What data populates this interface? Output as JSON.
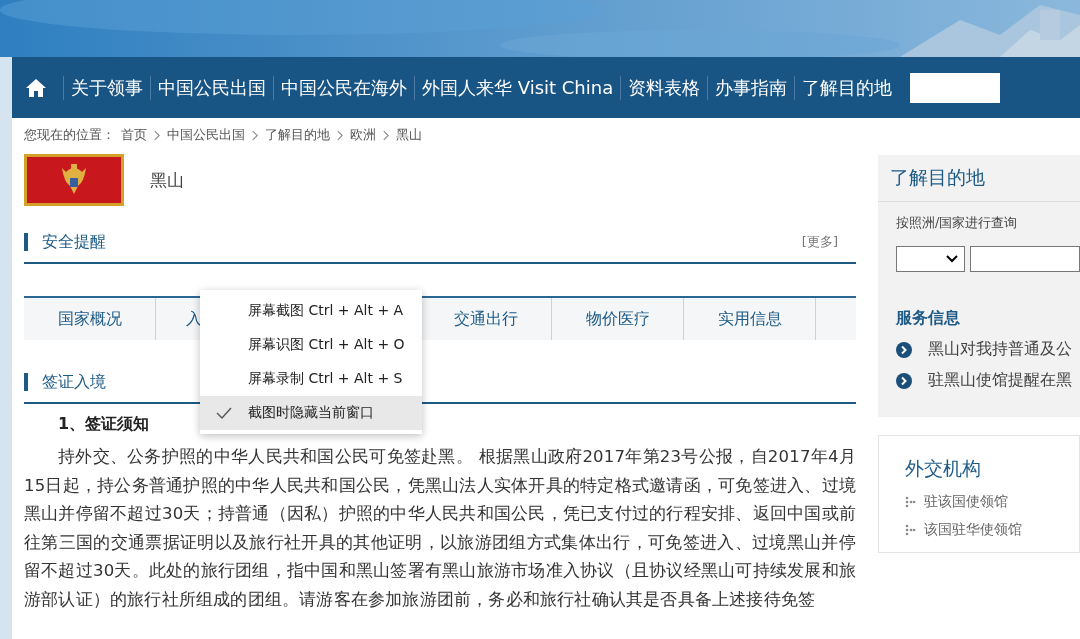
{
  "nav": {
    "items": [
      {
        "label": "关于领事"
      },
      {
        "label": "中国公民出国"
      },
      {
        "label": "中国公民在海外"
      },
      {
        "label": "外国人来华 Visit China"
      },
      {
        "label": "资料表格"
      },
      {
        "label": "办事指南"
      },
      {
        "label": "了解目的地"
      }
    ]
  },
  "breadcrumb": {
    "prefix": "您现在的位置：",
    "items": [
      "首页",
      "中国公民出国",
      "了解目的地",
      "欧洲",
      "黑山"
    ]
  },
  "country": {
    "name": "黑山"
  },
  "safety": {
    "title": "安全提醒",
    "more": "[更多]"
  },
  "tabs": [
    {
      "label": "国家概况"
    },
    {
      "label": "入",
      "kind": "covered"
    },
    {
      "label": "交通出行"
    },
    {
      "label": "物价医疗"
    },
    {
      "label": "实用信息"
    }
  ],
  "visa": {
    "title": "签证入境",
    "subtitle": "1、签证须知",
    "paragraph": "持外交、公务护照的中华人民共和国公民可免签赴黑。 根据黑山政府2017年第23号公报，自2017年4月15日起，持公务普通护照的中华人民共和国公民，凭黑山法人实体开具的特定格式邀请函，可免签进入、过境黑山并停留不超过30天；持普通（因私）护照的中华人民共和国公民，凭已支付过的行程安排、返回中国或前往第三国的交通票据证明以及旅行社开具的其他证明，以旅游团组方式集体出行，可免签进入、过境黑山并停留不超过30天。此处的旅行团组，指中国和黑山签署有黑山旅游市场准入协议（且协议经黑山可持续发展和旅游部认证）的旅行社所组成的团组。请游客在参加旅游团前，务必和旅行社确认其是否具备上述接待免签"
  },
  "context_menu": {
    "items": [
      {
        "label": "屏幕截图 Ctrl + Alt + A",
        "checked": false
      },
      {
        "label": "屏幕识图 Ctrl + Alt + O",
        "checked": false
      },
      {
        "label": "屏幕录制 Ctrl + Alt + S",
        "checked": false
      },
      {
        "label": "截图时隐藏当前窗口",
        "checked": true
      }
    ]
  },
  "sidebar": {
    "title": "了解目的地",
    "query_label": "按照洲/国家进行查询",
    "service_title": "服务信息",
    "service_items": [
      "黑山对我持普通及公",
      "驻黑山使馆提醒在黑"
    ],
    "diplomatic_title": "外交机构",
    "diplomatic_items": [
      "驻该国使领馆",
      "该国驻华使领馆"
    ]
  }
}
